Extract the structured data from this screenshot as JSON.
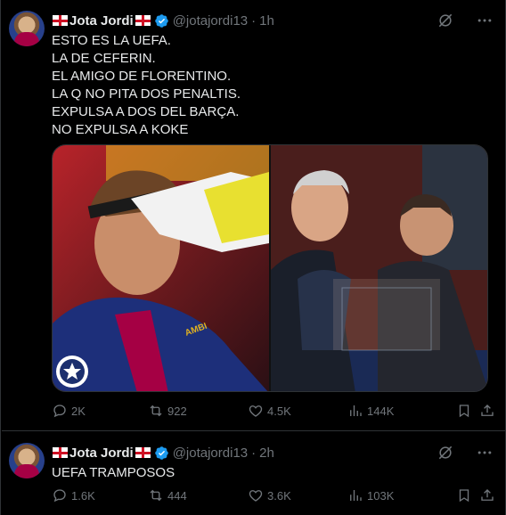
{
  "tweets": [
    {
      "name": "Jota Jordi",
      "handle": "@jotajordi13",
      "dot": "·",
      "time": "1h",
      "lines": [
        "ESTO ES LA UEFA.",
        "LA DE CEFERIN.",
        "EL AMIGO DE FLORENTINO.",
        "LA Q NO PITA DOS PENALTIS.",
        "EXPULSA A DOS DEL BARÇA.",
        "NO EXPULSA A KOKE"
      ],
      "media": {
        "left_photo_text": "AMBI",
        "left_icon": "champions-league-icon"
      },
      "replies": "2K",
      "reposts": "922",
      "likes": "4.5K",
      "views": "144K"
    },
    {
      "name": "Jota Jordi",
      "handle": "@jotajordi13",
      "dot": "·",
      "time": "2h",
      "lines": [
        "UEFA TRAMPOSOS"
      ],
      "replies": "1.6K",
      "reposts": "444",
      "likes": "3.6K",
      "views": "103K"
    }
  ],
  "colors": {
    "background": "#000000",
    "text": "#e7e9ea",
    "muted": "#71767b",
    "verified": "#1d9bf0",
    "border": "#2f3336"
  },
  "icons": [
    "england-flag-icon",
    "verified-badge-icon",
    "grok-icon",
    "more-icon",
    "reply-icon",
    "repost-icon",
    "like-icon",
    "views-icon",
    "bookmark-icon",
    "share-icon"
  ]
}
